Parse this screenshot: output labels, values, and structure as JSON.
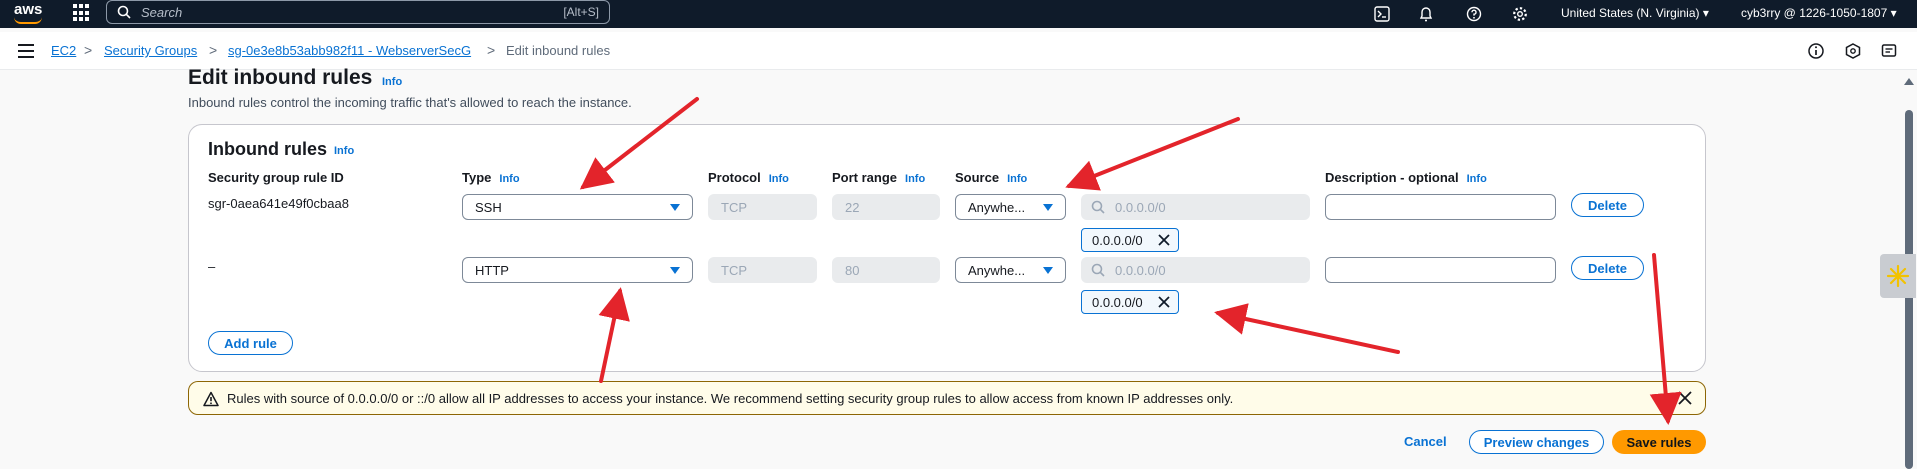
{
  "topnav": {
    "logo_text": "aws",
    "search_placeholder": "Search",
    "search_shortcut": "[Alt+S]",
    "region": "United States (N. Virginia) ▾",
    "account": "cyb3rry @ 1226-1050-1807 ▾",
    "icons": [
      "cloudshell-icon",
      "bell-icon",
      "help-icon",
      "gear-icon"
    ]
  },
  "breadcrumb": {
    "items": [
      "EC2",
      "Security Groups",
      "sg-0e3e8b53abb982f11 - WebserverSecG"
    ],
    "current": "Edit inbound rules",
    "separator": ">"
  },
  "page": {
    "title": "Edit inbound rules",
    "info": "Info",
    "description": "Inbound rules control the incoming traffic that's allowed to reach the instance."
  },
  "inbound": {
    "title": "Inbound rules",
    "info": "Info",
    "columns": {
      "rule_id": "Security group rule ID",
      "type": "Type",
      "protocol": "Protocol",
      "port_range": "Port range",
      "source": "Source",
      "description": "Description - optional"
    },
    "rows": [
      {
        "rule_id": "sgr-0aea641e49f0cbaa8",
        "type": "SSH",
        "protocol": "TCP",
        "port": "22",
        "source": "Anywhe...",
        "cidr_placeholder": "0.0.0.0/0",
        "token": "0.0.0.0/0",
        "description": "",
        "delete": "Delete"
      },
      {
        "rule_id": "–",
        "type": "HTTP",
        "protocol": "TCP",
        "port": "80",
        "source": "Anywhe...",
        "cidr_placeholder": "0.0.0.0/0",
        "token": "0.0.0.0/0",
        "description": "",
        "delete": "Delete"
      }
    ],
    "add_rule": "Add rule"
  },
  "warning": {
    "text": "Rules with source of 0.0.0.0/0 or ::/0 allow all IP addresses to access your instance. We recommend setting security group rules to allow access from known IP addresses only."
  },
  "actions": {
    "cancel": "Cancel",
    "preview": "Preview changes",
    "save": "Save rules"
  },
  "colors": {
    "nav_bg": "#0f1b2a",
    "link": "#0972d3",
    "primary": "#ff9900",
    "annotation": "#e3242b"
  }
}
